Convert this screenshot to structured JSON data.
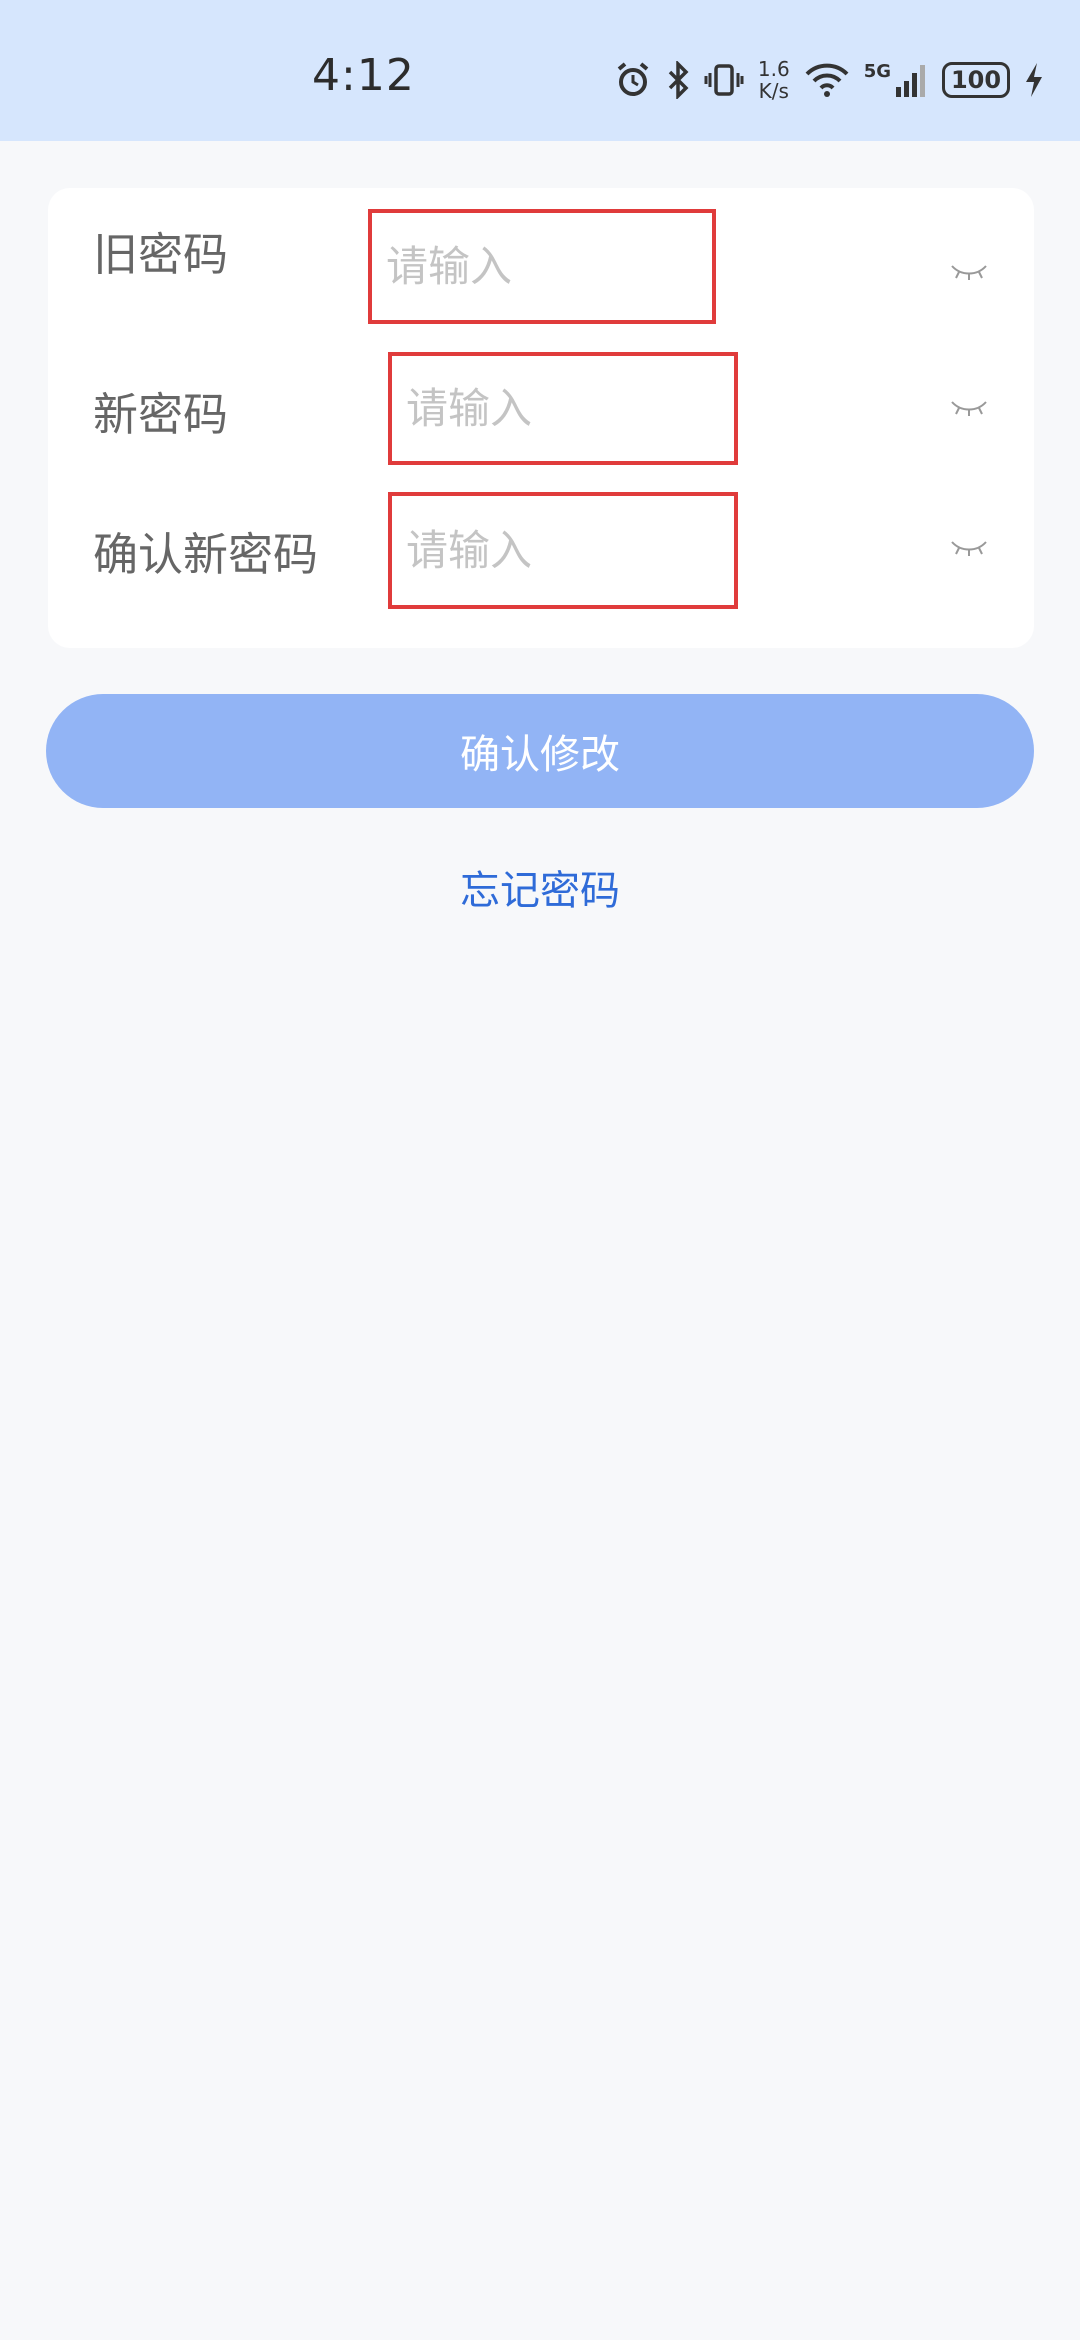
{
  "status_bar": {
    "time": "4:12",
    "speed_value": "1.6",
    "speed_unit": "K/s",
    "network": "5G",
    "battery": "100",
    "icons": [
      "alarm-icon",
      "bluetooth-icon",
      "vibrate-icon",
      "wifi-icon",
      "signal-icon",
      "battery-icon",
      "charging-icon"
    ]
  },
  "form": {
    "old_password": {
      "label": "旧密码",
      "placeholder": "请输入",
      "value": ""
    },
    "new_password": {
      "label": "新密码",
      "placeholder": "请输入",
      "value": ""
    },
    "confirm_password": {
      "label": "确认新密码",
      "placeholder": "请输入",
      "value": ""
    },
    "eye_icon": "eye-closed-icon"
  },
  "actions": {
    "confirm_label": "确认修改",
    "forgot_label": "忘记密码"
  },
  "colors": {
    "status_bar_bg": "#d6e6fd",
    "page_bg": "#f7f8fa",
    "button_bg": "#92b4f5",
    "link": "#2f6bd8",
    "highlight_border": "#e03b3b"
  }
}
